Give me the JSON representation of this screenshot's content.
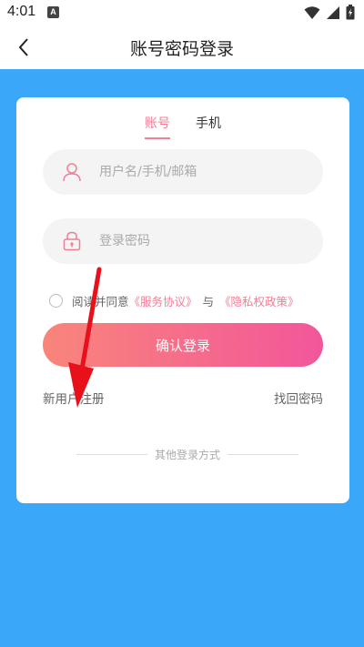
{
  "status_bar": {
    "time": "4:01",
    "notification_letter": "A"
  },
  "nav": {
    "title": "账号密码登录"
  },
  "tabs": [
    {
      "label": "账号",
      "active": true
    },
    {
      "label": "手机",
      "active": false
    }
  ],
  "username_field": {
    "placeholder": "用户名/手机/邮箱",
    "value": ""
  },
  "password_field": {
    "placeholder": "登录密码",
    "value": ""
  },
  "agreement": {
    "prefix": "阅读并同意",
    "service_link": "《服务协议》",
    "conjunction": "与",
    "privacy_link": "《隐私权政策》",
    "checked": false
  },
  "submit": {
    "label": "确认登录"
  },
  "register": {
    "label": "新用户注册"
  },
  "forgot": {
    "label": "找回密码"
  },
  "other_login": {
    "label": "其他登录方式"
  },
  "colors": {
    "accent": "#f07f96",
    "background_blue": "#3aa7f8",
    "button_gradient_start": "#f9857a",
    "button_gradient_end": "#f2569b",
    "annotation_arrow": "#e8101b"
  }
}
